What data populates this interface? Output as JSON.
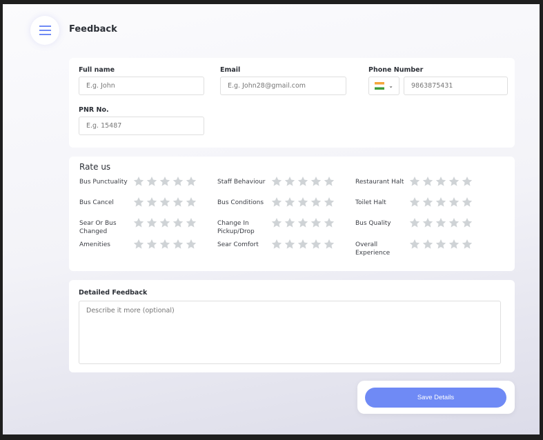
{
  "header": {
    "title": "Feedback",
    "menu_icon": "hamburger-icon"
  },
  "form": {
    "full_name": {
      "label": "Full name",
      "placeholder": "E.g. John"
    },
    "email": {
      "label": "Email",
      "placeholder": "E.g. John28@gmail.com"
    },
    "phone": {
      "label": "Phone Number",
      "country": "India",
      "placeholder": "9863875431"
    },
    "pnr": {
      "label": "PNR No.",
      "placeholder": "E.g. 15487"
    }
  },
  "rating": {
    "title": "Rate us",
    "max_stars": 5,
    "items": [
      {
        "label": "Bus Punctuality",
        "value": 0
      },
      {
        "label": "Staff Behaviour",
        "value": 0
      },
      {
        "label": "Restaurant Halt",
        "value": 0
      },
      {
        "label": "Bus Cancel",
        "value": 0
      },
      {
        "label": "Bus Conditions",
        "value": 0
      },
      {
        "label": "Toilet Halt",
        "value": 0
      },
      {
        "label": "Sear Or Bus Changed",
        "value": 0
      },
      {
        "label": "Change In Pickup/Drop",
        "value": 0
      },
      {
        "label": "Bus Quality",
        "value": 0
      },
      {
        "label": "Amenities",
        "value": 0
      },
      {
        "label": "Sear Comfort",
        "value": 0
      },
      {
        "label": "Overall Experience",
        "value": 0
      }
    ]
  },
  "detailed": {
    "label": "Detailed Feedback",
    "placeholder": "Describe it more (optional)"
  },
  "save_label": "Save Details",
  "colors": {
    "accent": "#6f8af5",
    "star": "#cfd3d6"
  }
}
